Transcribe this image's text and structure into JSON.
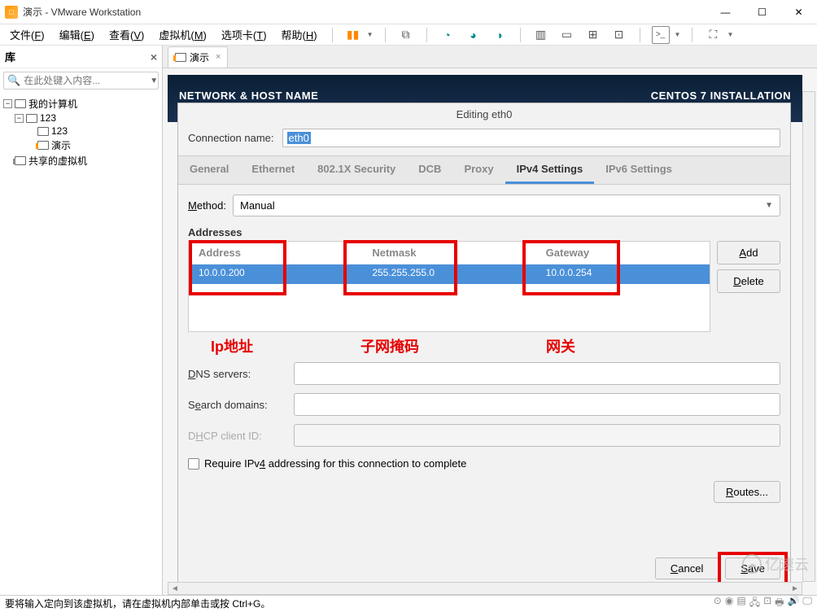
{
  "window": {
    "title": "演示 - VMware Workstation",
    "minimize": "—",
    "maximize": "☐",
    "close": "✕"
  },
  "menu": {
    "file": "文件(F)",
    "edit": "编辑(E)",
    "view": "查看(V)",
    "vm": "虚拟机(M)",
    "tabs": "选项卡(T)",
    "help": "帮助(H)"
  },
  "sidebar": {
    "title": "库",
    "search_placeholder": "在此处键入内容...",
    "tree": {
      "my_computer": "我的计算机",
      "n123_a": "123",
      "n123_b": "123",
      "demo": "演示",
      "shared": "共享的虚拟机"
    }
  },
  "tab": {
    "label": "演示"
  },
  "banner": {
    "left": "NETWORK & HOST NAME",
    "right": "CENTOS 7 INSTALLATION"
  },
  "dialog": {
    "title": "Editing eth0",
    "conn_label": "Connection name:",
    "conn_value": "eth0",
    "tabs": {
      "general": "General",
      "ethernet": "Ethernet",
      "security": "802.1X Security",
      "dcb": "DCB",
      "proxy": "Proxy",
      "ipv4": "IPv4 Settings",
      "ipv6": "IPv6 Settings"
    },
    "method_label": "Method:",
    "method_value": "Manual",
    "addresses_label": "Addresses",
    "addr_head": {
      "address": "Address",
      "netmask": "Netmask",
      "gateway": "Gateway"
    },
    "addr_row": {
      "address": "10.0.0.200",
      "netmask": "255.255.255.0",
      "gateway": "10.0.0.254"
    },
    "add_btn": "Add",
    "delete_btn": "Delete",
    "anno": {
      "ip": "Ip地址",
      "netmask": "子网掩码",
      "gateway": "网关"
    },
    "dns_label": "DNS servers:",
    "search_label": "Search domains:",
    "dhcp_label": "DHCP client ID:",
    "require_ipv4": "Require IPv4 addressing for this connection to complete",
    "routes": "Routes...",
    "cancel": "Cancel",
    "save": "Save"
  },
  "status": {
    "text": "要将输入定向到该虚拟机，请在虚拟机内部单击或按 Ctrl+G。"
  },
  "watermark": "亿速云"
}
